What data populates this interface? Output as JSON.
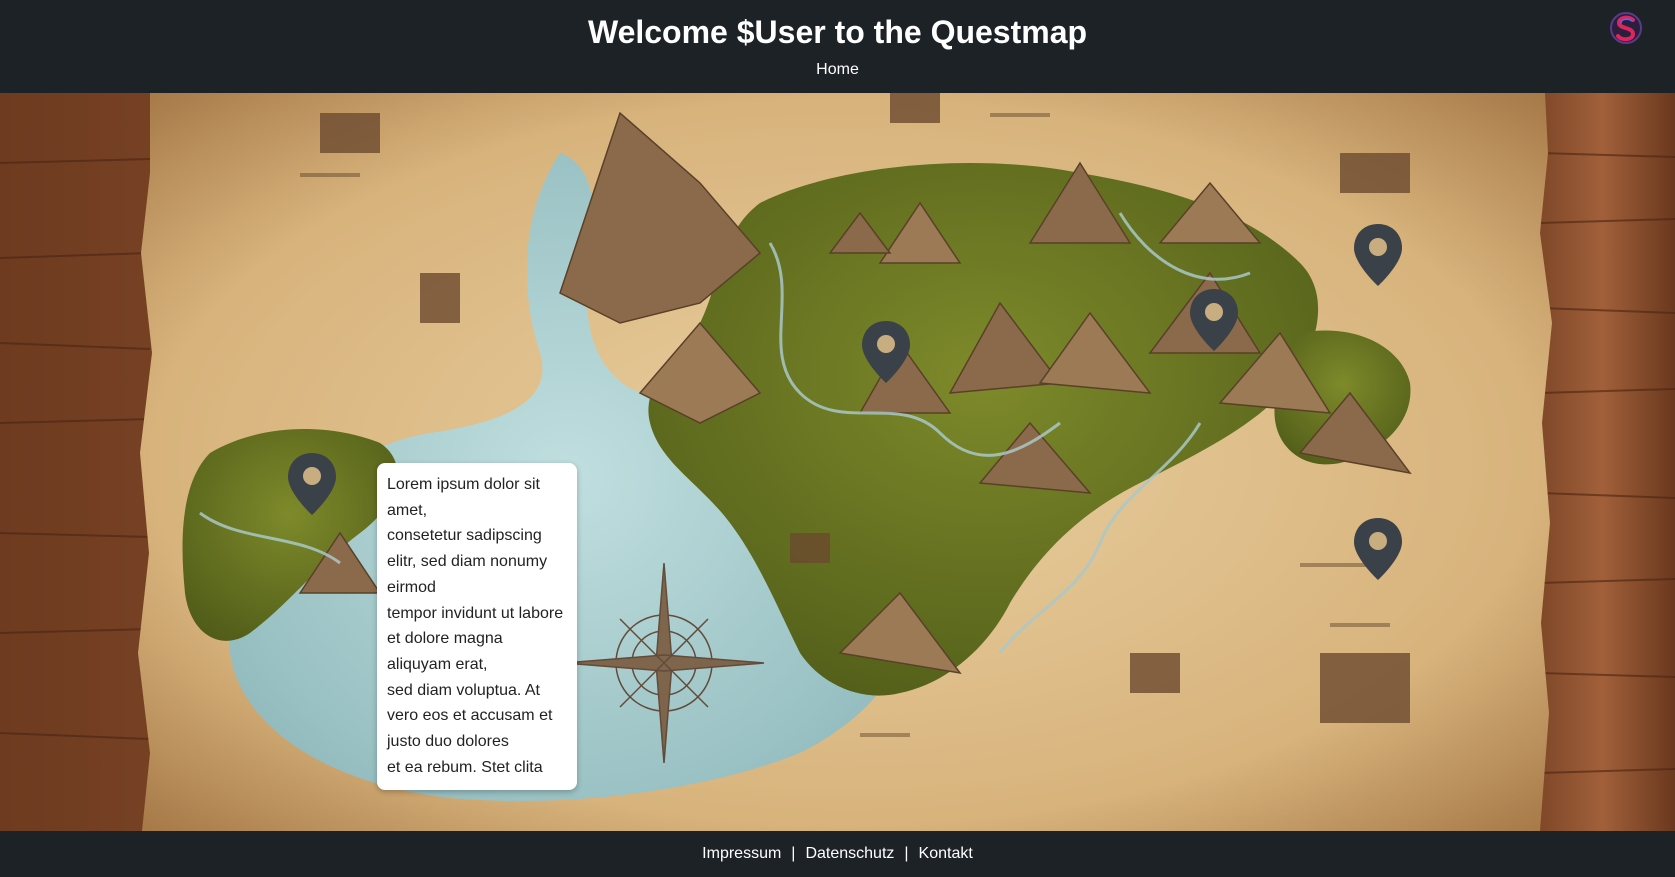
{
  "header": {
    "title": "Welcome $User to the Questmap",
    "nav": {
      "home_label": "Home"
    },
    "logo_icon": "s-logo-icon"
  },
  "map": {
    "background_icon": "parchment-map-illustration",
    "pin_icon": "map-pin-icon",
    "pins_count_visible": 5
  },
  "popup": {
    "lines": [
      "Lorem ipsum dolor sit amet,",
      "consetetur sadipscing elitr, sed diam nonumy eirmod",
      "tempor invidunt ut labore et dolore magna aliquyam erat,",
      "sed diam voluptua. At vero eos et accusam et justo duo dolores",
      "et ea rebum. Stet clita"
    ]
  },
  "footer": {
    "links": [
      "Impressum",
      "Datenschutz",
      "Kontakt"
    ],
    "separator": "|"
  },
  "colors": {
    "bar_background": "#1d2226",
    "text": "#ffffff",
    "pin": "#3b4148",
    "popup_background": "#ffffff",
    "logo_accent": "#e0245e"
  }
}
